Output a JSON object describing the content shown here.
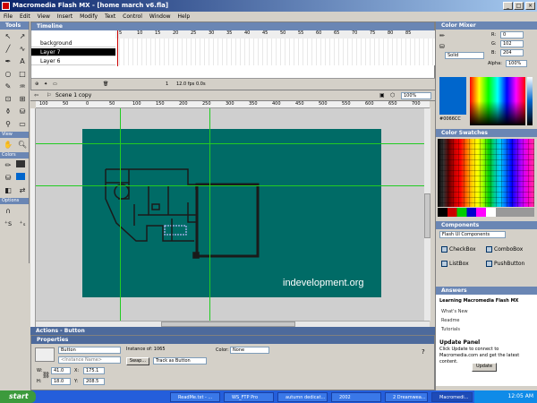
{
  "window": {
    "title": "Macromedia Flash MX - [home march v6.fla]"
  },
  "menu": [
    "File",
    "Edit",
    "View",
    "Insert",
    "Modify",
    "Text",
    "Control",
    "Window",
    "Help"
  ],
  "tools_panel": {
    "title": "Tools",
    "view_label": "View",
    "colors_label": "Colors",
    "options_label": "Options"
  },
  "timeline": {
    "title": "Timeline",
    "layers": [
      {
        "name": "background"
      },
      {
        "name": "Layer 7"
      },
      {
        "name": "Layer 6"
      }
    ],
    "frame_numbers": [
      "5",
      "10",
      "15",
      "20",
      "25",
      "30",
      "35",
      "40",
      "45",
      "50",
      "55",
      "60",
      "65",
      "70",
      "75",
      "80",
      "85"
    ],
    "current_frame": "1",
    "fps": "12.0 fps",
    "time": "0.0s"
  },
  "scene": {
    "label": "Scene 1 copy",
    "zoom": "100%"
  },
  "ruler_ticks": [
    "100",
    "50",
    "0",
    "50",
    "100",
    "150",
    "200",
    "250",
    "300",
    "350",
    "400",
    "450",
    "500",
    "550",
    "600",
    "650",
    "700"
  ],
  "stage": {
    "brand_text": "indevelopment.org",
    "bg_color": "#006b66"
  },
  "actions_bar": {
    "label": "Actions - Button"
  },
  "properties": {
    "title": "Properties",
    "symbol_type": "Button",
    "instance_of_label": "Instance of:",
    "instance_of_value": "1065",
    "instance_name_placeholder": "<Instance Name>",
    "swap_label": "Swap...",
    "track_label": "Track as Button",
    "color_label": "Color:",
    "color_value": "None",
    "w_label": "W:",
    "w_value": "41.0",
    "h_label": "H:",
    "h_value": "18.0",
    "x_label": "X:",
    "x_value": "175.1",
    "y_label": "Y:",
    "y_value": "208.5"
  },
  "color_mixer": {
    "title": "Color Mixer",
    "r_label": "R:",
    "r_value": "0",
    "g_label": "G:",
    "g_value": "102",
    "b_label": "B:",
    "b_value": "204",
    "fill_type": "Solid",
    "alpha_label": "Alpha:",
    "alpha_value": "100%",
    "hex": "#0066CC"
  },
  "color_swatches": {
    "title": "Color Swatches"
  },
  "components": {
    "title": "Components",
    "set": "Flash UI Components",
    "items": [
      {
        "label": "CheckBox"
      },
      {
        "label": "ComboBox"
      },
      {
        "label": "ListBox"
      },
      {
        "label": "PushButton"
      }
    ]
  },
  "answers": {
    "title": "Answers",
    "heading": "Learning Macromedia Flash MX",
    "links": [
      "What's New",
      "Readme",
      "Tutorials"
    ],
    "update_title": "Update Panel",
    "update_text": "Click Update to connect to Macromedia.com and get the latest content.",
    "update_button": "Update"
  },
  "taskbar": {
    "start": "start",
    "tasks": [
      "ReadMe.txt - ...",
      "WS_FTP Pro",
      "autumn dedicat...",
      "2002",
      "2 Dreamwea...",
      "Macromedi..."
    ],
    "clock": "12:05 AM"
  },
  "colors": {
    "title_gradient_start": "#0a246a",
    "panel_header": "#6a86b4",
    "guide": "#22cc22"
  }
}
